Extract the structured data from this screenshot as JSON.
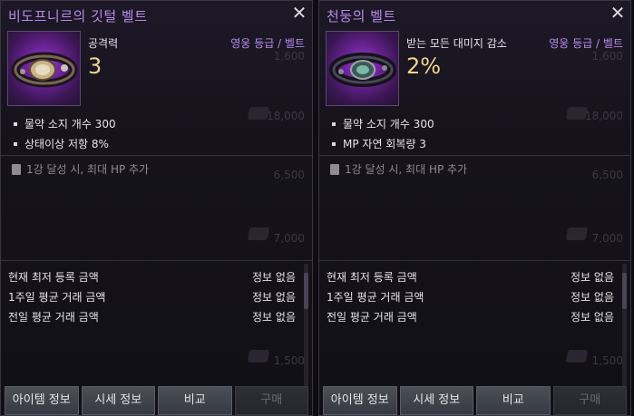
{
  "panels": [
    {
      "title": "비도프니르의 깃털 벨트",
      "stat_label": "공격력",
      "stat_value": "3",
      "grade": "영웅 등급 / 벨트",
      "bullets": [
        "물약 소지 개수 300",
        "상태이상 저항 8%"
      ],
      "enhance_note": "1강 달성 시, 최대 HP 추가",
      "market": [
        {
          "label": "현재 최저 등록 금액",
          "value": "정보 없음"
        },
        {
          "label": "1주일 평균 거래 금액",
          "value": "정보 없음"
        },
        {
          "label": "전일 평균 거래 금액",
          "value": "정보 없음"
        }
      ],
      "buttons": [
        "아이템 정보",
        "시세 정보",
        "비교",
        "구매"
      ]
    },
    {
      "title": "천둥의 벨트",
      "stat_label": "받는 모든 대미지 감소",
      "stat_value": "2%",
      "grade": "영웅 등급 / 벨트",
      "bullets": [
        "물약 소지 개수 300",
        "MP 자연 회복량 3"
      ],
      "enhance_note": "1강 달성 시, 최대 HP 추가",
      "market": [
        {
          "label": "현재 최저 등록 금액",
          "value": "정보 없음"
        },
        {
          "label": "1주일 평균 거래 금액",
          "value": "정보 없음"
        },
        {
          "label": "전일 평균 거래 금액",
          "value": "정보 없음"
        }
      ],
      "buttons": [
        "아이템 정보",
        "시세 정보",
        "비교",
        "구매"
      ]
    }
  ],
  "background_prices": [
    "1,600",
    "18,000",
    "6,500",
    "7,000",
    "1,500"
  ],
  "close_glyph": "✕",
  "colors": {
    "title": "#b58ae8",
    "grade": "#b58ae8",
    "stat_value": "#f0d58a"
  }
}
